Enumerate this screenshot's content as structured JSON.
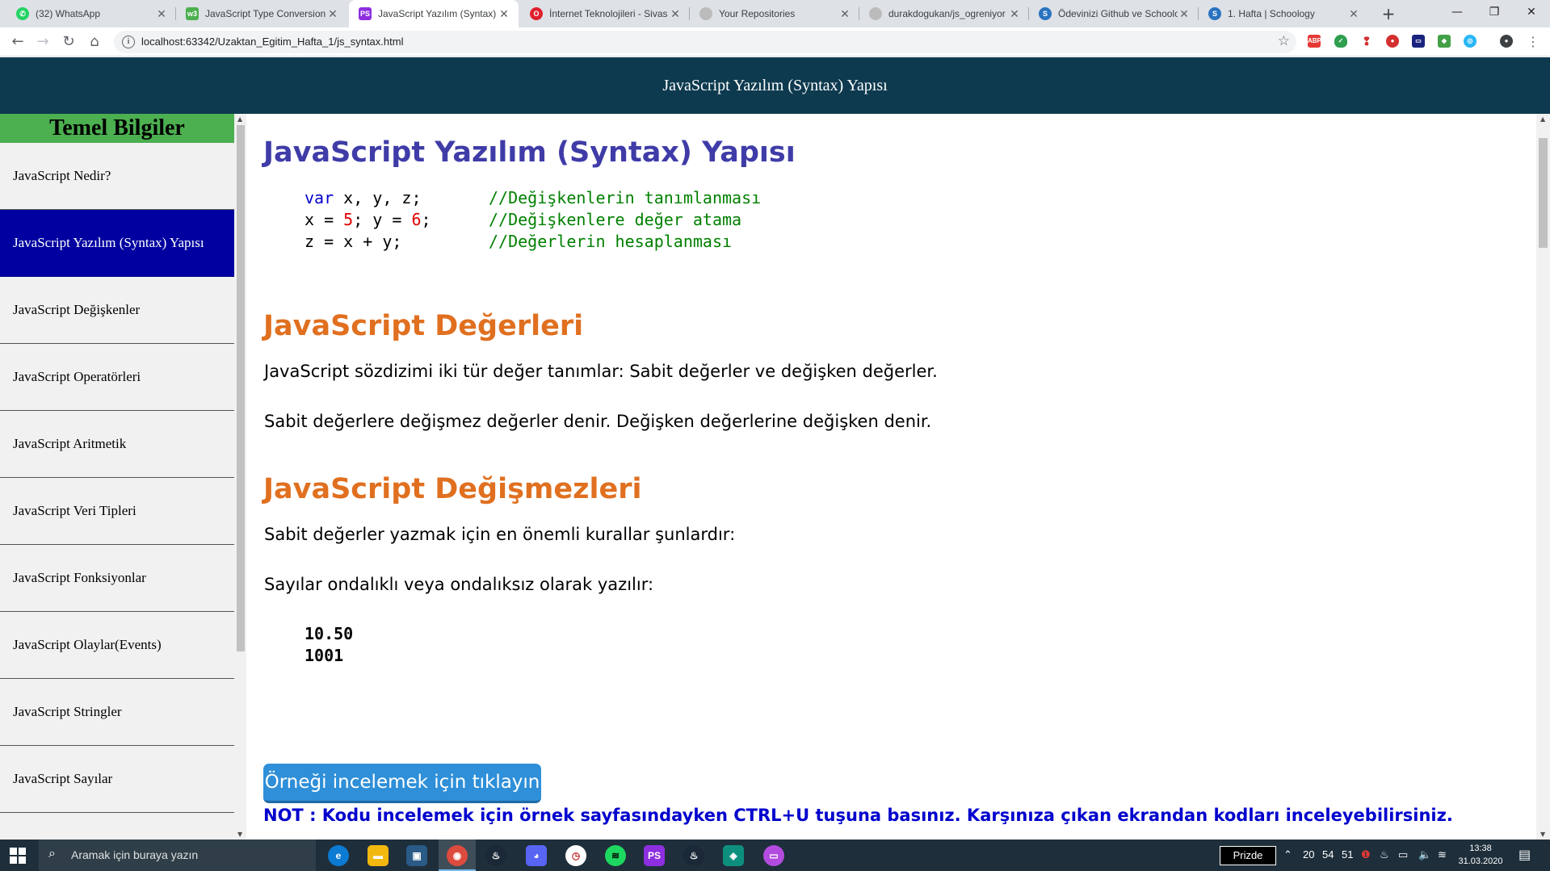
{
  "browser": {
    "tabs": [
      {
        "title": "(32) WhatsApp",
        "icon": "whatsapp-icon",
        "color": "#25d366",
        "active": false
      },
      {
        "title": "JavaScript Type Conversion",
        "icon": "w3-icon",
        "color": "#4caf50",
        "active": false
      },
      {
        "title": "JavaScript Yazılım (Syntax) Y",
        "icon": "phpstorm-icon",
        "color": "#8d2fe0",
        "active": true
      },
      {
        "title": "İnternet Teknolojileri - Sivas",
        "icon": "opera-icon",
        "color": "#e0202e",
        "active": false
      },
      {
        "title": "Your Repositories",
        "icon": "github-icon",
        "color": "#333333",
        "active": false
      },
      {
        "title": "durakdogukan/js_ogreniyor",
        "icon": "github-icon",
        "color": "#333333",
        "active": false
      },
      {
        "title": "Ödevinizi Github ve Schoolo",
        "icon": "schoology-icon",
        "color": "#2a73c0",
        "active": false
      },
      {
        "title": "1. Hafta | Schoology",
        "icon": "schoology-icon",
        "color": "#2a73c0",
        "active": false
      }
    ],
    "url": "localhost:63342/Uzaktan_Egitim_Hafta_1/js_syntax.html"
  },
  "page": {
    "header_title": "JavaScript Yazılım (Syntax) Yapısı",
    "sidebar": {
      "heading": "Temel Bilgiler",
      "items": [
        {
          "label": "JavaScript Nedir?",
          "active": false
        },
        {
          "label": "JavaScript Yazılım (Syntax) Yapısı",
          "active": true
        },
        {
          "label": "JavaScript Değişkenler",
          "active": false
        },
        {
          "label": "JavaScript Operatörleri",
          "active": false
        },
        {
          "label": "JavaScript Aritmetik",
          "active": false
        },
        {
          "label": "JavaScript Veri Tipleri",
          "active": false
        },
        {
          "label": "JavaScript Fonksiyonlar",
          "active": false
        },
        {
          "label": "JavaScript Olaylar(Events)",
          "active": false
        },
        {
          "label": "JavaScript Stringler",
          "active": false
        },
        {
          "label": "JavaScript Sayılar",
          "active": false
        }
      ]
    },
    "main": {
      "title": "JavaScript Yazılım (Syntax) Yapısı",
      "code": {
        "l1_kw": "var",
        "l1_rest": " x, y, z;",
        "l1_cm": "//Değişkenlerin tanımlanması",
        "l2_a": "x = ",
        "l2_n1": "5",
        "l2_b": "; y = ",
        "l2_n2": "6",
        "l2_c": ";",
        "l2_cm": "//Değişkenlere değer atama",
        "l3_code": "z = x + y;",
        "l3_cm": "//Değerlerin hesaplanması"
      },
      "values_heading": "JavaScript Değerleri",
      "values_p1": "JavaScript sözdizimi iki tür değer tanımlar: Sabit değerler ve değişken değerler.",
      "values_p2": "Sabit değerlere değişmez değerler denir. Değişken değerlerine değişken denir.",
      "literals_heading": "JavaScript Değişmezleri",
      "literals_p1": "Sabit değerler yazmak için en önemli kurallar şunlardır:",
      "literals_p2": "Sayılar ondalıklı veya ondalıksız olarak yazılır:",
      "number_examples": [
        "10.50",
        "1001"
      ],
      "example_button": "Örneği incelemek için tıklayın",
      "note": "NOT : Kodu incelemek için örnek sayfasındayken CTRL+U tuşuna basınız. Karşınıza çıkan ekrandan kodları inceleyebilirsiniz."
    }
  },
  "taskbar": {
    "search_placeholder": "Aramak için buraya yazın",
    "tray_box": "Prizde",
    "tray_numbers": [
      "20",
      "54",
      "51"
    ],
    "time": "13:38",
    "date": "31.03.2020"
  },
  "colors": {
    "header_bg": "#0e3a4f",
    "sidebar_heading_bg": "#4caf50",
    "sidebar_active_bg": "#0000a0",
    "title_color": "#3f3ca8",
    "section_color": "#e07020",
    "note_color": "#0000cd",
    "button_color": "#2f8fd8"
  }
}
